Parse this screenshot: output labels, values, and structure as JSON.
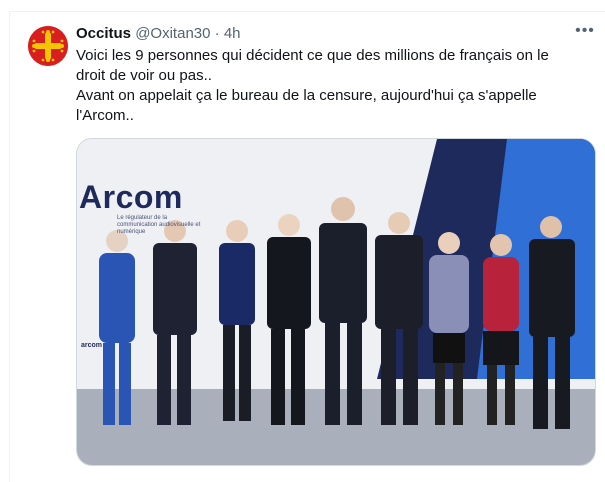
{
  "tweet": {
    "author_name": "Occitus",
    "handle": "@Oxitan30",
    "separator": "·",
    "time": "4h",
    "more_label": "•••",
    "text_lines": [
      "Voici les 9 personnes qui décident ce que des millions de français on le",
      "droit de voir ou pas..",
      "Avant on appelait ça le bureau de la censure, aujourd'hui ça s'appelle",
      "l'Arcom.."
    ]
  },
  "media": {
    "logo_text": "Arcom",
    "logo_subtitle": "Le régulateur de la communication audiovisuelle et numérique",
    "small_logo": "arcom",
    "people_count": 9
  },
  "colors": {
    "avatar_bg": "#d81e1e",
    "avatar_cross": "#f4c400",
    "backdrop_navy": "#1f2a5c",
    "backdrop_blue": "#2f6fd6"
  }
}
